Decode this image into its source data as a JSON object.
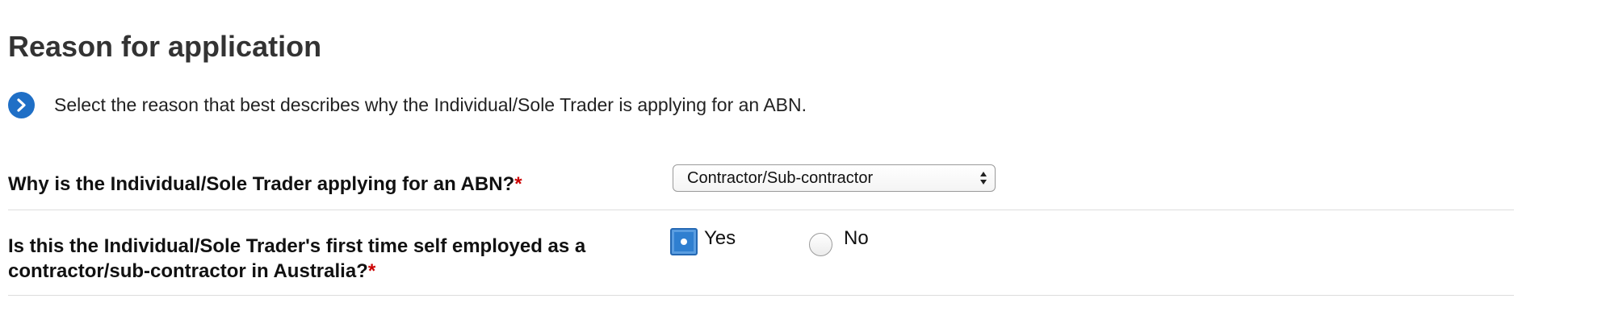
{
  "section": {
    "title": "Reason for application"
  },
  "instruction": {
    "icon": "chevron-right-icon",
    "text": "Select the reason that best describes why the Individual/Sole Trader is applying for an ABN."
  },
  "questions": [
    {
      "label": "Why is the Individual/Sole Trader applying for an ABN?",
      "required_marker": "*",
      "control": "select",
      "selected_value": "Contractor/Sub-contractor"
    },
    {
      "label": "Is this the Individual/Sole Trader's first time self employed as a contractor/sub-contractor in Australia?",
      "required_marker": "*",
      "control": "radio",
      "options": [
        {
          "label": "Yes",
          "checked": true
        },
        {
          "label": "No",
          "checked": false
        }
      ]
    }
  ],
  "colors": {
    "accent": "#1f6fc6",
    "required": "#cc0000",
    "heading": "#333333"
  }
}
